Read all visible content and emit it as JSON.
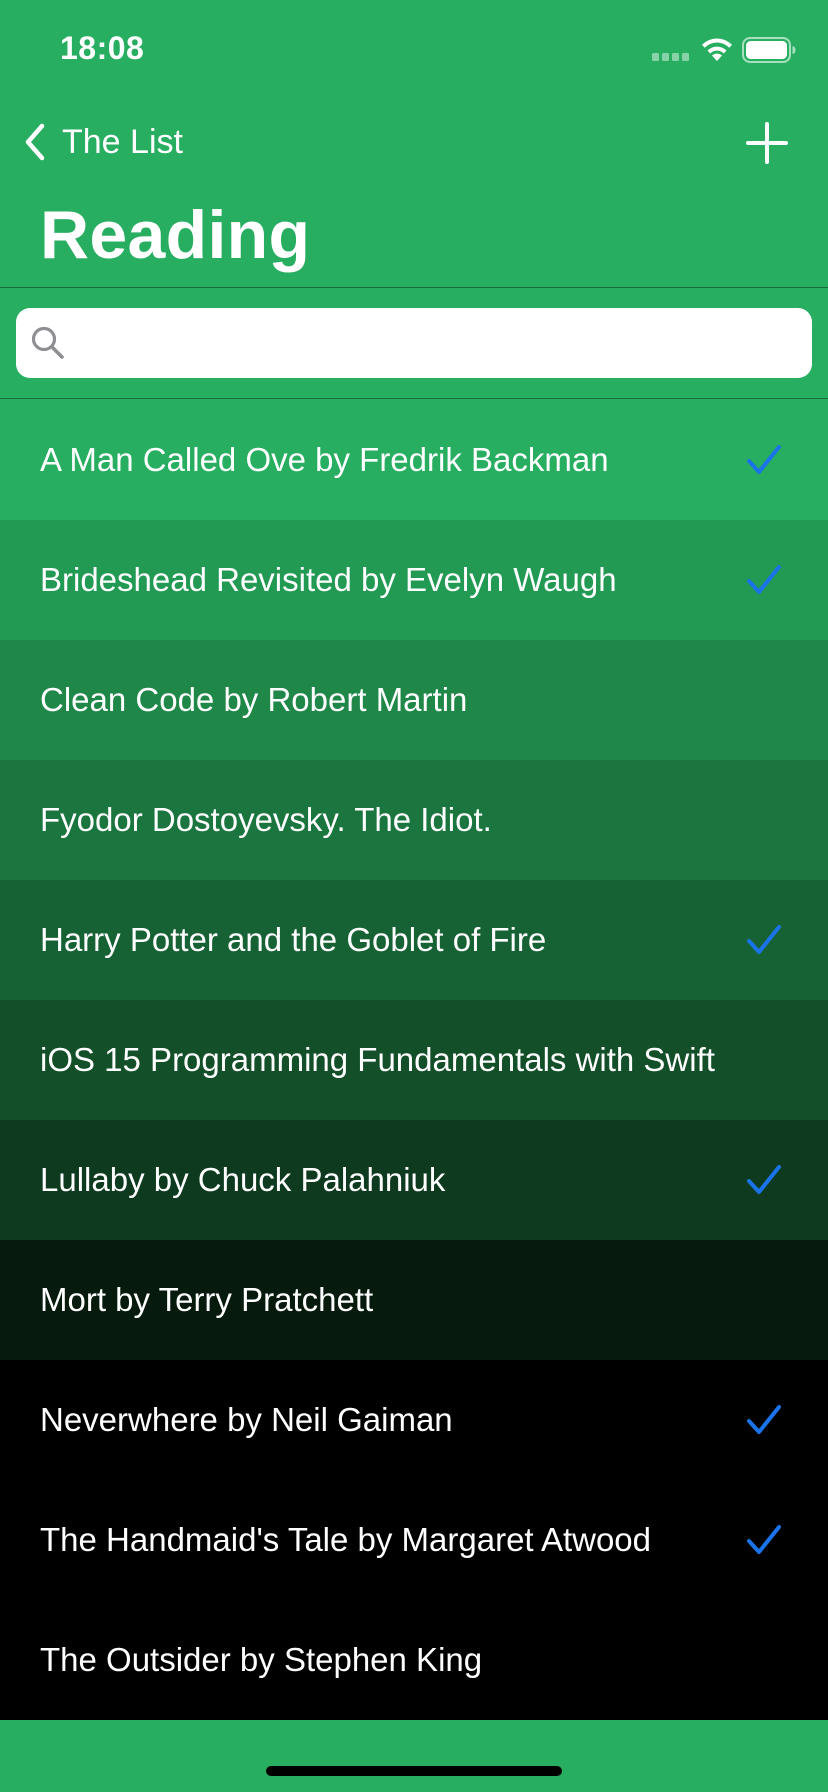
{
  "status_bar": {
    "time": "18:08"
  },
  "nav": {
    "back_label": "The List",
    "title": "Reading",
    "back_icon": "chevron-left-icon",
    "add_icon": "plus-icon"
  },
  "search": {
    "placeholder": "",
    "value": ""
  },
  "colors": {
    "accent_green": "#27ae60",
    "checkmark_blue": "#1a73e8"
  },
  "books": [
    {
      "title": "A Man Called Ove by Fredrik Backman",
      "checked": true,
      "bg": "#27ae60"
    },
    {
      "title": "Brideshead Revisited by Evelyn Waugh",
      "checked": true,
      "bg": "#229a54"
    },
    {
      "title": "Clean Code by Robert Martin",
      "checked": false,
      "bg": "#1f8748"
    },
    {
      "title": "Fyodor Dostoyevsky. The Idiot.",
      "checked": false,
      "bg": "#1b753e"
    },
    {
      "title": "Harry Potter and the Goblet of Fire",
      "checked": true,
      "bg": "#176234"
    },
    {
      "title": "iOS 15 Programming Fundamentals with Swift",
      "checked": false,
      "bg": "#134f29"
    },
    {
      "title": "Lullaby by Chuck Palahniuk",
      "checked": true,
      "bg": "#0e3b1f"
    },
    {
      "title": "Mort by Terry Pratchett",
      "checked": false,
      "bg": "#061a0d"
    },
    {
      "title": "Neverwhere by Neil Gaiman",
      "checked": true,
      "bg": "#000000"
    },
    {
      "title": "The Handmaid's Tale by Margaret Atwood",
      "checked": true,
      "bg": "#000000"
    },
    {
      "title": "The Outsider by Stephen King",
      "checked": false,
      "bg": "#000000"
    }
  ]
}
